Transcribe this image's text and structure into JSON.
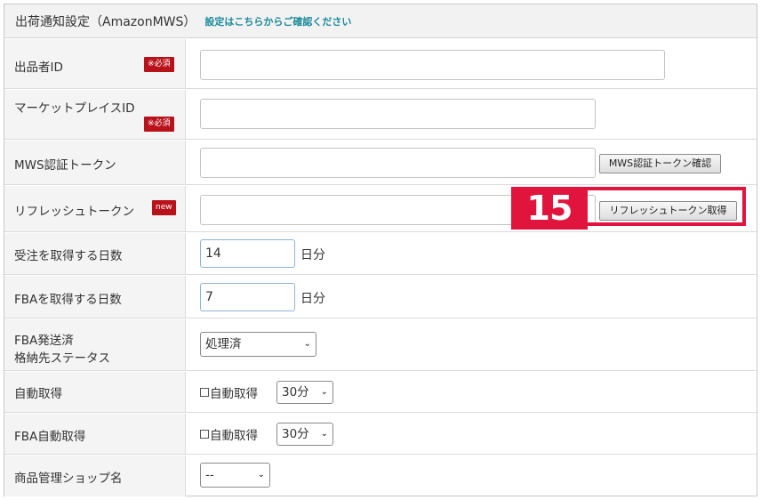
{
  "header": {
    "title": "出荷通知設定（AmazonMWS）",
    "link": "設定はこちらからご確認ください"
  },
  "badges": {
    "required": "※必須",
    "new": "new"
  },
  "fields": {
    "seller_id": {
      "label": "出品者ID",
      "value": ""
    },
    "marketplace_id": {
      "label": "マーケットプレイスID",
      "value": ""
    },
    "mws_token": {
      "label": "MWS認証トークン",
      "value": "",
      "button": "MWS認証トークン確認"
    },
    "refresh_token": {
      "label": "リフレッシュトークン",
      "value": "",
      "button": "リフレッシュトークン取得"
    },
    "order_days": {
      "label": "受注を取得する日数",
      "value": "14",
      "unit": "日分"
    },
    "fba_days": {
      "label": "FBAを取得する日数",
      "value": "7",
      "unit": "日分"
    },
    "fba_status": {
      "label_line1": "FBA発送済",
      "label_line2": "格納先ステータス",
      "selected": "処理済"
    },
    "auto_fetch": {
      "label": "自動取得",
      "checkbox_label": "自動取得",
      "checked": false,
      "interval": "30分"
    },
    "fba_auto_fetch": {
      "label": "FBA自動取得",
      "checkbox_label": "自動取得",
      "checked": false,
      "interval": "30分"
    },
    "shop_name": {
      "label": "商品管理ショップ名",
      "selected": "--"
    }
  },
  "annotation": {
    "step_number": "15",
    "color": "#e0143c"
  },
  "colors": {
    "badge_red": "#b8121b",
    "link_teal": "#1a8a9a"
  }
}
